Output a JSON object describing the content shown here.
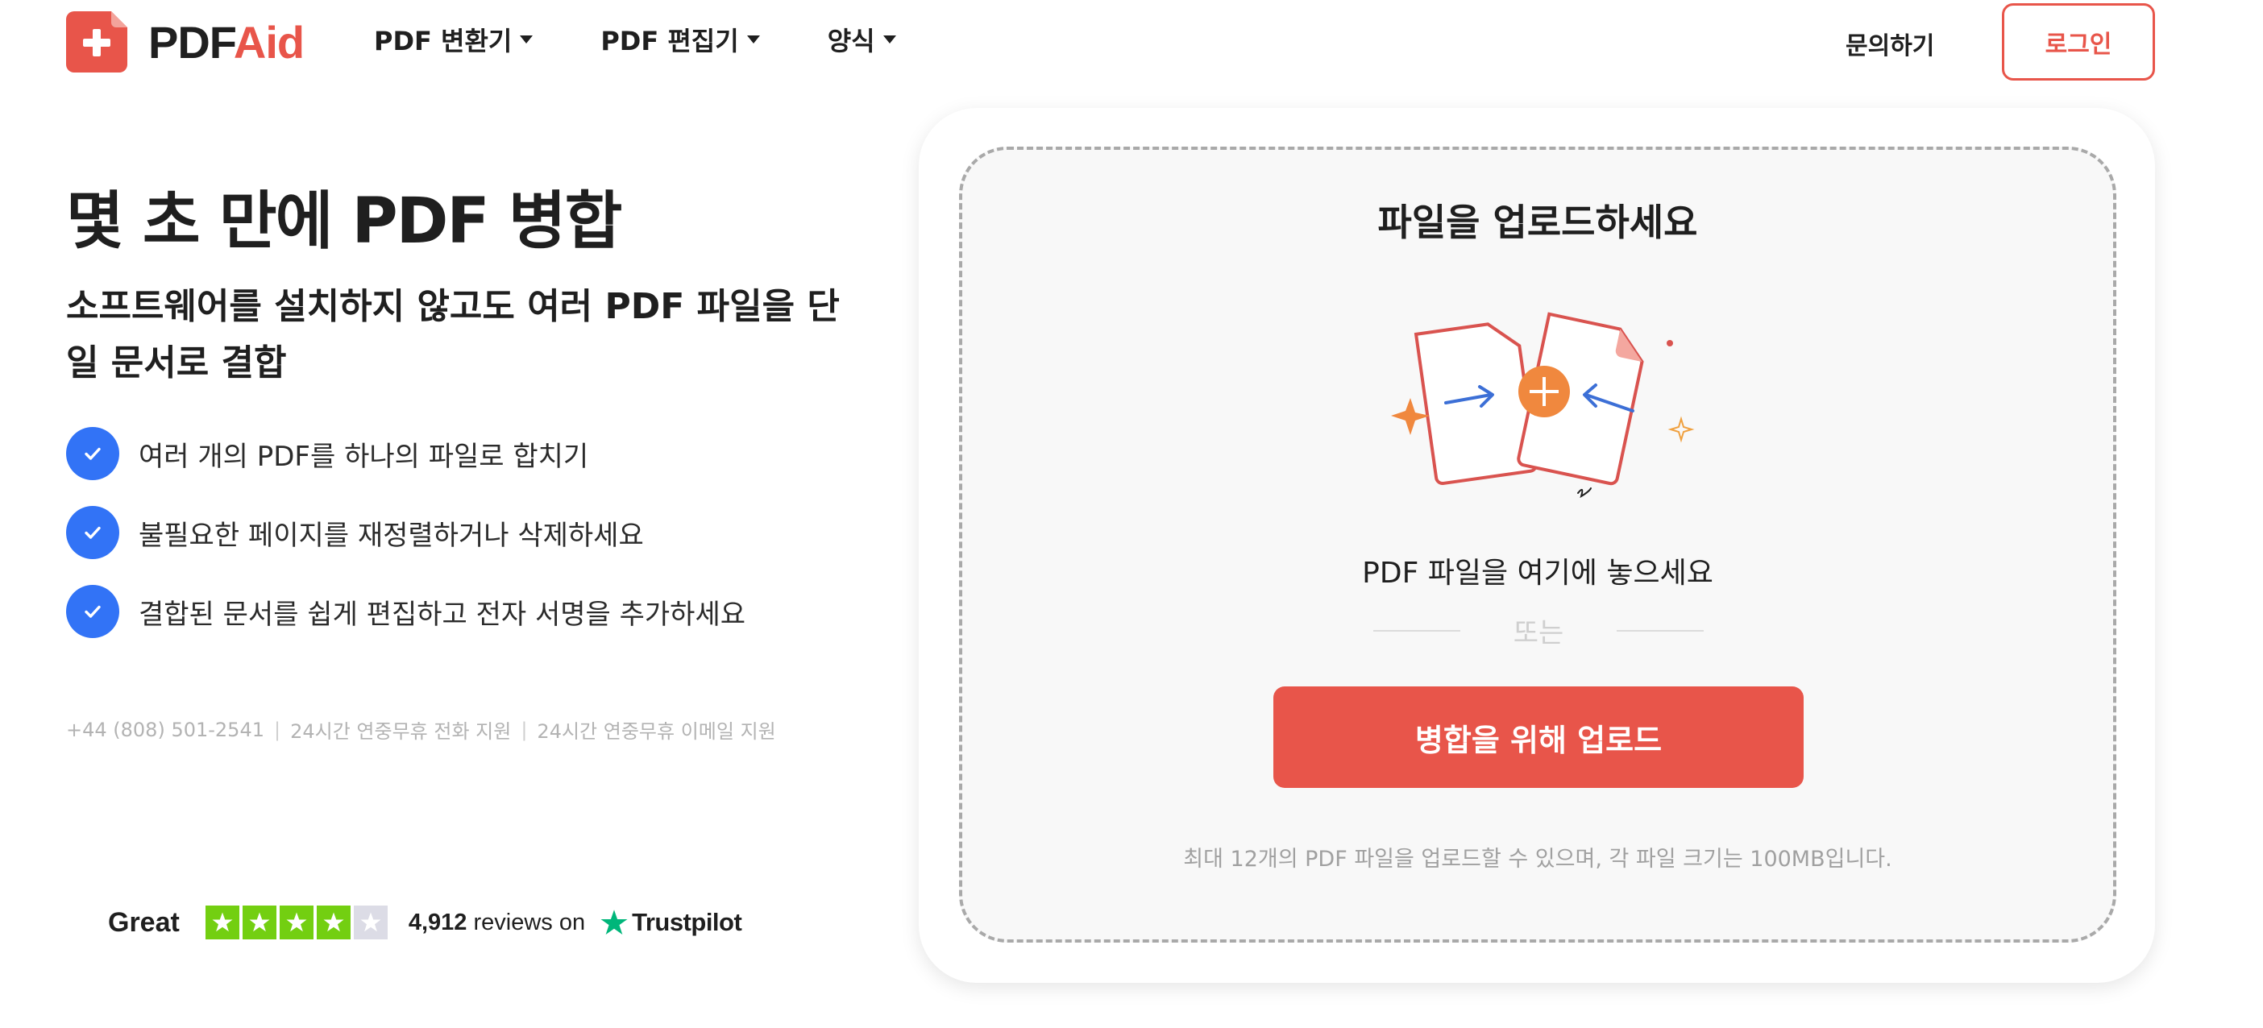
{
  "header": {
    "logo": {
      "part1": "PDF",
      "part2": "Aid",
      "icon": "plus-icon"
    },
    "nav": [
      {
        "label": "PDF 변환기"
      },
      {
        "label": "PDF 편집기"
      },
      {
        "label": "양식"
      }
    ],
    "contact_label": "문의하기",
    "login_label": "로그인"
  },
  "hero": {
    "title": "몇 초 만에 PDF 병합",
    "subtitle": "소프트웨어를 설치하지 않고도 여러 PDF 파일을 단일 문서로 결합",
    "features": [
      {
        "text": "여러 개의 PDF를 하나의 파일로 합치기"
      },
      {
        "text": "불필요한 페이지를 재정렬하거나 삭제하세요"
      },
      {
        "text": "결합된 문서를 쉽게 편집하고 전자 서명을 추가하세요"
      }
    ],
    "support": {
      "phone": "+44 (808) 501-2541",
      "phone_support": "24시간 연중무휴 전화 지원",
      "email_support": "24시간 연중무휴 이메일 지원",
      "separator": "|"
    }
  },
  "trust": {
    "rating_word": "Great",
    "stars_filled": 4,
    "stars_total": 5,
    "review_count": "4,912",
    "reviews_on": "reviews on",
    "brand": "Trustpilot",
    "star_color": "#73cf11",
    "brand_star_color": "#00b67a"
  },
  "upload": {
    "title": "파일을 업로드하세요",
    "drop_text": "PDF 파일을 여기에 놓으세요",
    "or_text": "또는",
    "button_label": "병합을 위해 업로드",
    "limit_text": "최대 12개의 PDF 파일을 업로드할 수 있으며, 각 파일 크기는 100MB입니다."
  },
  "colors": {
    "accent": "#e8554a",
    "check_blue": "#3273f6",
    "merge_orange": "#f0883e"
  }
}
